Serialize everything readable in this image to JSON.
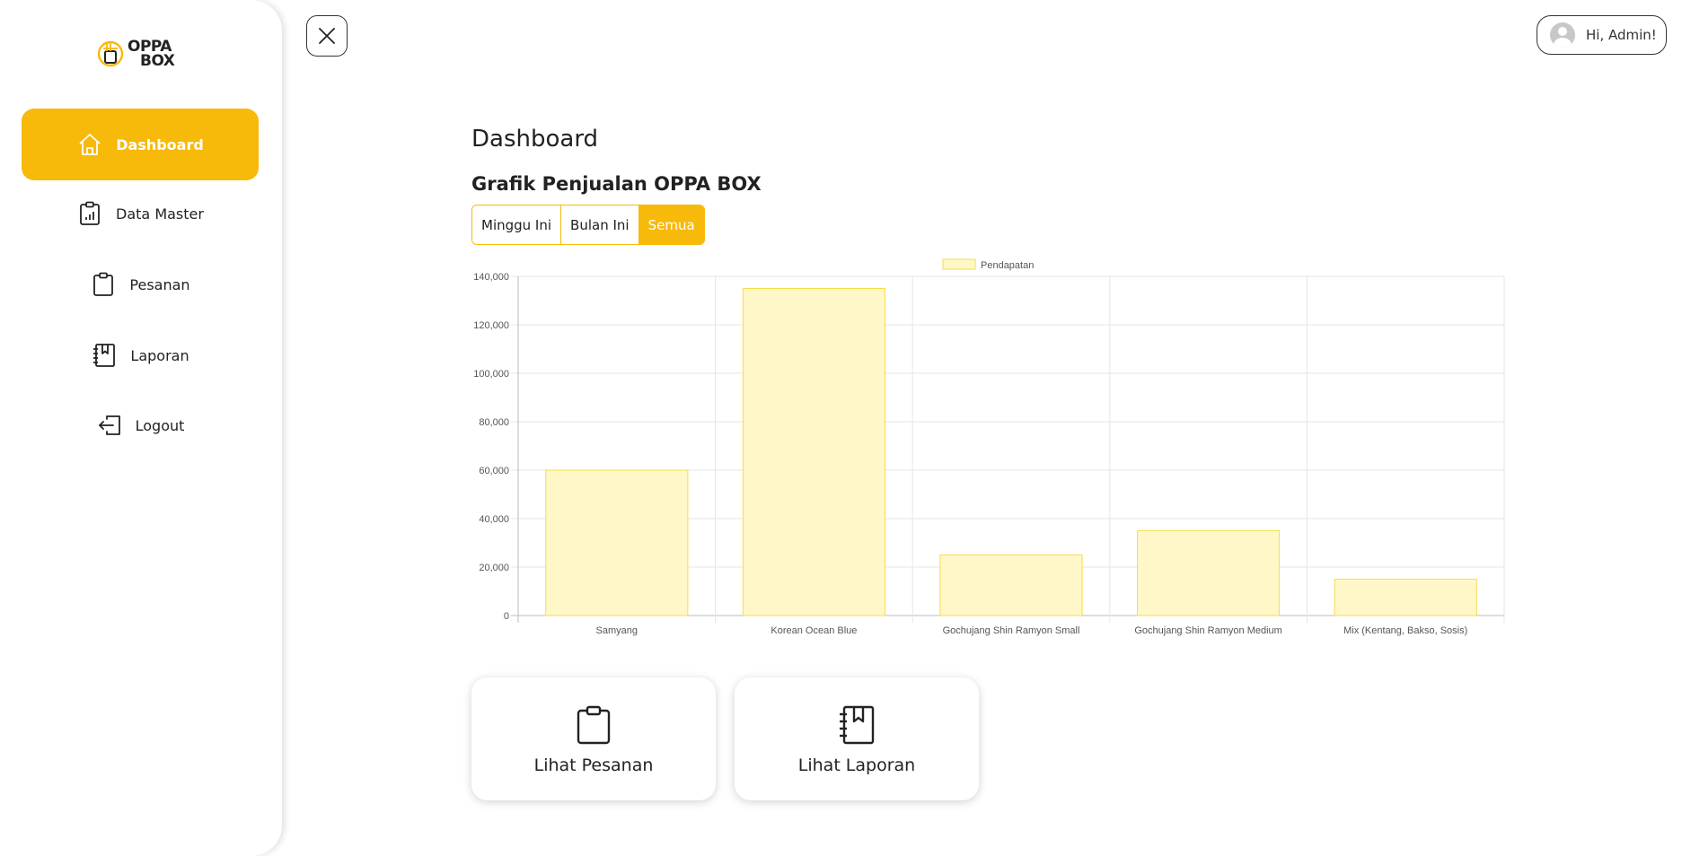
{
  "brand": {
    "logo_text_line1": "OPPA",
    "logo_text_line2": "BOX",
    "accent_color": "#f7b90a"
  },
  "sidebar": {
    "items": [
      {
        "label": "Dashboard",
        "icon": "home-icon",
        "active": true
      },
      {
        "label": "Data Master",
        "icon": "clipboard-chart-icon",
        "active": false
      },
      {
        "label": "Pesanan",
        "icon": "clipboard-icon",
        "active": false
      },
      {
        "label": "Laporan",
        "icon": "notebook-bookmark-icon",
        "active": false
      },
      {
        "label": "Logout",
        "icon": "logout-icon",
        "active": false
      }
    ]
  },
  "header": {
    "close_icon": "close-icon",
    "user_label": "Hi, Admin!"
  },
  "main": {
    "title": "Dashboard",
    "chart_title": "Grafik Penjualan OPPA BOX",
    "filters": [
      {
        "label": "Minggu Ini",
        "active": false
      },
      {
        "label": "Bulan Ini",
        "active": false
      },
      {
        "label": "Semua",
        "active": true
      }
    ],
    "cards": [
      {
        "label": "Lihat Pesanan",
        "icon": "clipboard-icon"
      },
      {
        "label": "Lihat Laporan",
        "icon": "notebook-bookmark-icon"
      }
    ]
  },
  "chart_data": {
    "type": "bar",
    "categories": [
      "Samyang",
      "Korean Ocean Blue",
      "Gochujang Shin Ramyon Small",
      "Gochujang Shin Ramyon Medium",
      "Mix (Kentang, Bakso, Sosis)"
    ],
    "series": [
      {
        "name": "Pendapatan",
        "values": [
          60000,
          135000,
          25000,
          35000,
          15000
        ],
        "fill": "#fff7c8",
        "stroke": "#f7dc4a"
      }
    ],
    "ylim": [
      0,
      140000
    ],
    "yticks": [
      "0",
      "20,000",
      "40,000",
      "60,000",
      "80,000",
      "100,000",
      "120,000",
      "140,000"
    ],
    "grid": true,
    "legend_position": "top-center"
  }
}
